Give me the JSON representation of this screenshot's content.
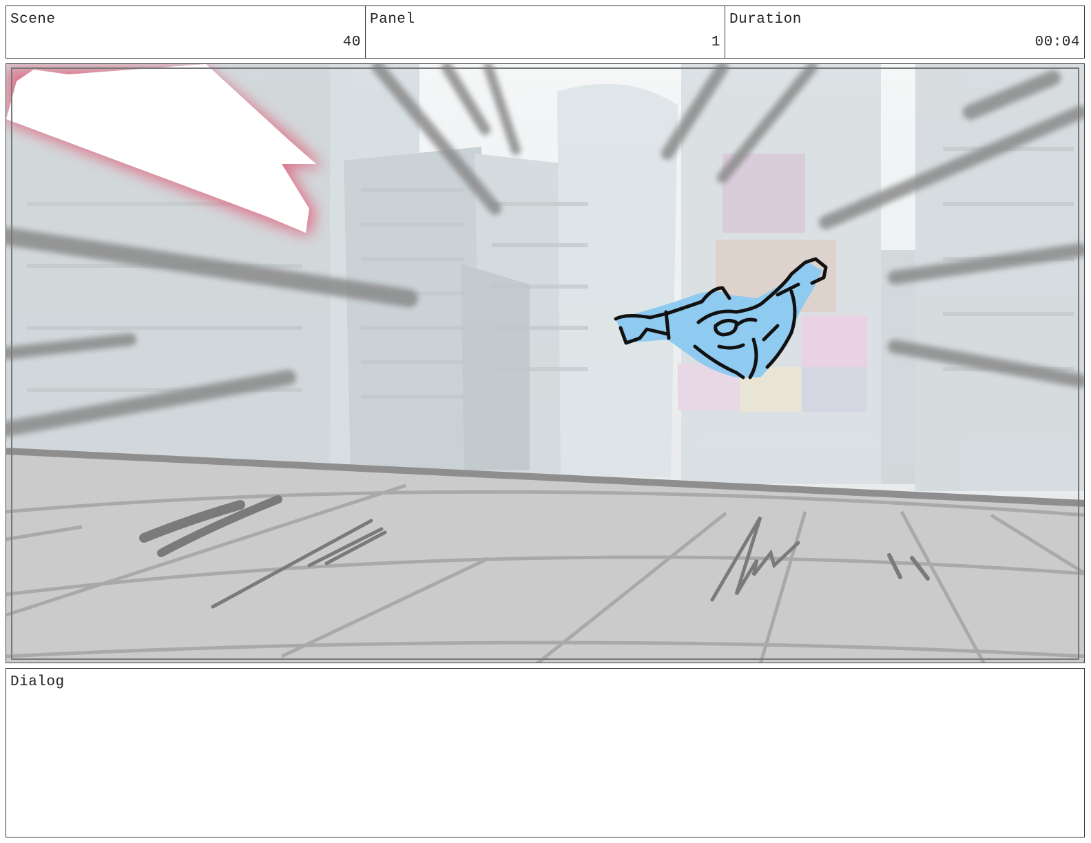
{
  "header": {
    "scene": {
      "label": "Scene",
      "value": "40"
    },
    "panel": {
      "label": "Panel",
      "value": "1"
    },
    "duration": {
      "label": "Duration",
      "value": "00:04"
    }
  },
  "dialog": {
    "label": "Dialog"
  },
  "colors": {
    "frame_border": "#444444",
    "sky": "#f2f4f5",
    "buildings": "#c9d1d6",
    "ground": "#cbcbcb",
    "figure_fill": "#8fcaf0",
    "flash_red": "#e0607a"
  },
  "icons": {
    "storyboard_drawing": "flying-hero-sketch"
  }
}
